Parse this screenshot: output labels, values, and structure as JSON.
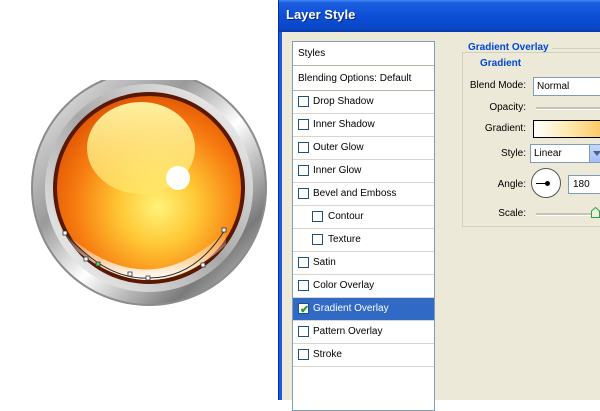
{
  "dialog": {
    "title": "Layer Style"
  },
  "styles_panel": {
    "header_styles": "Styles",
    "header_blending": "Blending Options: Default",
    "items": [
      {
        "label": "Drop Shadow",
        "checked": false,
        "sub": false,
        "selected": false
      },
      {
        "label": "Inner Shadow",
        "checked": false,
        "sub": false,
        "selected": false
      },
      {
        "label": "Outer Glow",
        "checked": false,
        "sub": false,
        "selected": false
      },
      {
        "label": "Inner Glow",
        "checked": false,
        "sub": false,
        "selected": false
      },
      {
        "label": "Bevel and Emboss",
        "checked": false,
        "sub": false,
        "selected": false
      },
      {
        "label": "Contour",
        "checked": false,
        "sub": true,
        "selected": false
      },
      {
        "label": "Texture",
        "checked": false,
        "sub": true,
        "selected": false
      },
      {
        "label": "Satin",
        "checked": false,
        "sub": false,
        "selected": false
      },
      {
        "label": "Color Overlay",
        "checked": false,
        "sub": false,
        "selected": false
      },
      {
        "label": "Gradient Overlay",
        "checked": true,
        "sub": false,
        "selected": true
      },
      {
        "label": "Pattern Overlay",
        "checked": false,
        "sub": false,
        "selected": false
      },
      {
        "label": "Stroke",
        "checked": false,
        "sub": false,
        "selected": false
      }
    ]
  },
  "gradient_overlay": {
    "group_title": "Gradient Overlay",
    "sub_title": "Gradient",
    "blend_mode_label": "Blend Mode:",
    "blend_mode_value": "Normal",
    "opacity_label": "Opacity:",
    "gradient_label": "Gradient:",
    "gradient_colors": [
      "#ffffff",
      "#ffe9ad",
      "#fbbd4e"
    ],
    "style_label": "Style:",
    "style_value": "Linear",
    "angle_label": "Angle:",
    "angle_value": "180",
    "scale_label": "Scale:"
  },
  "colors": {
    "titlebar": "#0b4fd6",
    "selection": "#316ac5",
    "group_title": "#0046d5"
  }
}
